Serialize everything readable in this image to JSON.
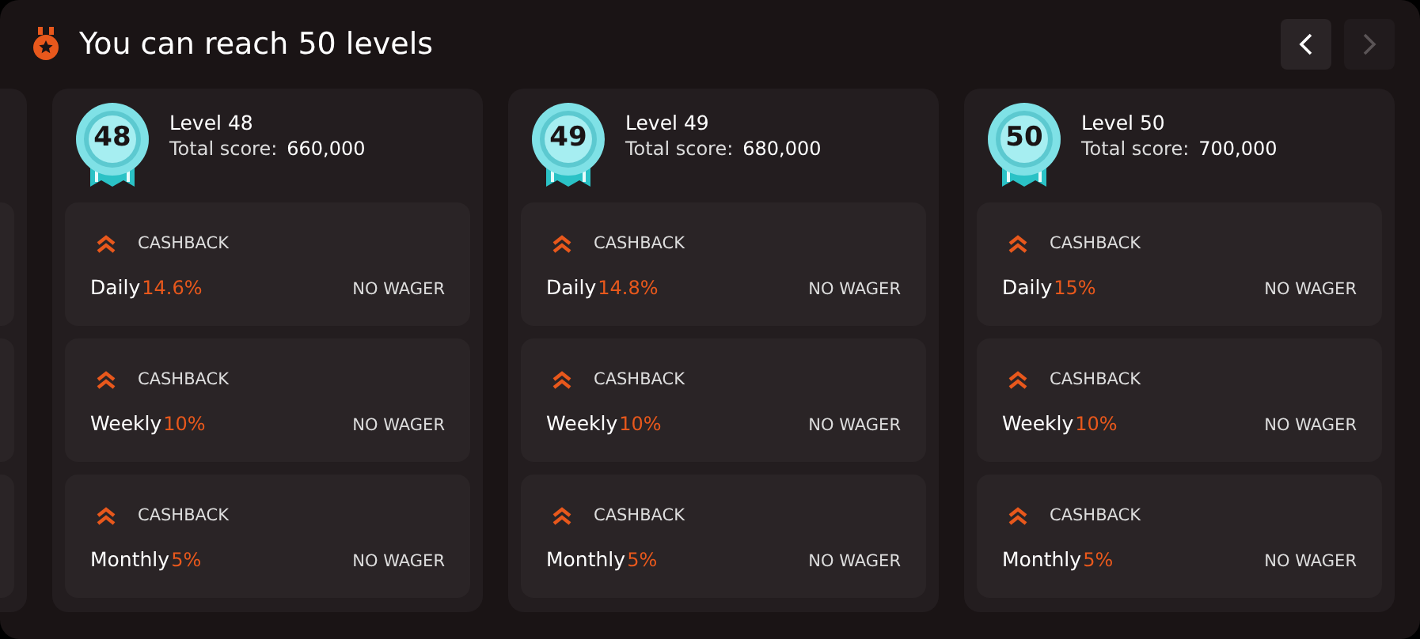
{
  "header": {
    "title": "You can reach 50 levels"
  },
  "nav": [
    {
      "kind": "prev",
      "disabled": false
    },
    {
      "kind": "next",
      "disabled": true
    }
  ],
  "levels": [
    {
      "badge": "48",
      "name": "Level 48",
      "score_label": "Total score:",
      "score": "660,000",
      "perks": [
        {
          "label": "CASHBACK",
          "period": "Daily",
          "value": "14.6%",
          "wager": "NO WAGER"
        },
        {
          "label": "CASHBACK",
          "period": "Weekly",
          "value": "10%",
          "wager": "NO WAGER"
        },
        {
          "label": "CASHBACK",
          "period": "Monthly",
          "value": "5%",
          "wager": "NO WAGER"
        }
      ]
    },
    {
      "badge": "49",
      "name": "Level 49",
      "score_label": "Total score:",
      "score": "680,000",
      "perks": [
        {
          "label": "CASHBACK",
          "period": "Daily",
          "value": "14.8%",
          "wager": "NO WAGER"
        },
        {
          "label": "CASHBACK",
          "period": "Weekly",
          "value": "10%",
          "wager": "NO WAGER"
        },
        {
          "label": "CASHBACK",
          "period": "Monthly",
          "value": "5%",
          "wager": "NO WAGER"
        }
      ]
    },
    {
      "badge": "50",
      "name": "Level 50",
      "score_label": "Total score:",
      "score": "700,000",
      "perks": [
        {
          "label": "CASHBACK",
          "period": "Daily",
          "value": "15%",
          "wager": "NO WAGER"
        },
        {
          "label": "CASHBACK",
          "period": "Weekly",
          "value": "10%",
          "wager": "NO WAGER"
        },
        {
          "label": "CASHBACK",
          "period": "Monthly",
          "value": "5%",
          "wager": "NO WAGER"
        }
      ]
    }
  ]
}
